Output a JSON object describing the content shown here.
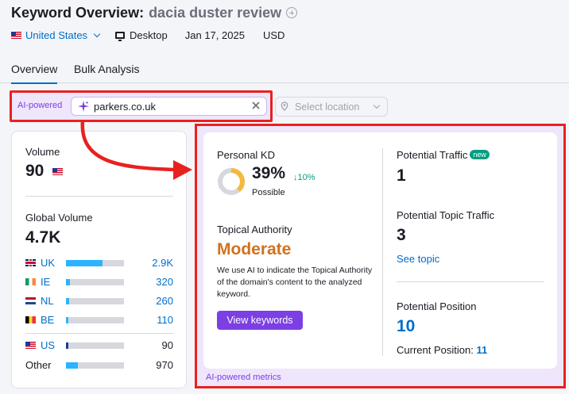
{
  "header": {
    "title": "Keyword Overview:",
    "keyword": "dacia duster review",
    "country": "United States",
    "device": "Desktop",
    "date": "Jan 17, 2025",
    "currency": "USD"
  },
  "tabs": [
    {
      "label": "Overview",
      "active": true
    },
    {
      "label": "Bulk Analysis",
      "active": false
    }
  ],
  "ai_bar": {
    "label": "AI-powered",
    "domain_value": "parkers.co.uk",
    "location_placeholder": "Select location"
  },
  "volume_card": {
    "volume_label": "Volume",
    "volume_value": "90",
    "global_label": "Global Volume",
    "global_value": "4.7K",
    "countries": [
      {
        "code": "UK",
        "value": "2.9K",
        "share": 0.63
      },
      {
        "code": "IE",
        "value": "320",
        "share": 0.07
      },
      {
        "code": "NL",
        "value": "260",
        "share": 0.06
      },
      {
        "code": "BE",
        "value": "110",
        "share": 0.03
      }
    ],
    "us": {
      "code": "US",
      "value": "90",
      "share": 0.02
    },
    "other": {
      "code": "Other",
      "value": "970",
      "share": 0.21
    }
  },
  "ai_metrics": {
    "personal_kd_label": "Personal KD",
    "personal_kd_value": "39%",
    "personal_kd_percent": 39,
    "personal_kd_trend": "↓10%",
    "personal_kd_sub": "Possible",
    "topical_authority_label": "Topical Authority",
    "topical_authority_value": "Moderate",
    "topical_authority_desc": "We use AI to indicate the Topical Authority of the domain's content to the analyzed keyword.",
    "view_keywords_button": "View keywords",
    "potential_traffic_label": "Potential Traffic",
    "new_badge": "new",
    "potential_traffic_value": "1",
    "potential_topic_traffic_label": "Potential Topic Traffic",
    "potential_topic_traffic_value": "3",
    "see_topic_link": "See topic",
    "potential_position_label": "Potential Position",
    "potential_position_value": "10",
    "current_position_label": "Current Position:",
    "current_position_value": "11",
    "footer_label": "AI-powered metrics"
  },
  "colors": {
    "accent_blue": "#006dca",
    "purple": "#7b3fe4",
    "highlight_red": "#e8211f",
    "moderate_orange": "#d1711d",
    "kd_donut_fill": "#f5b93f",
    "bar_fill": "#2bb3ff"
  }
}
